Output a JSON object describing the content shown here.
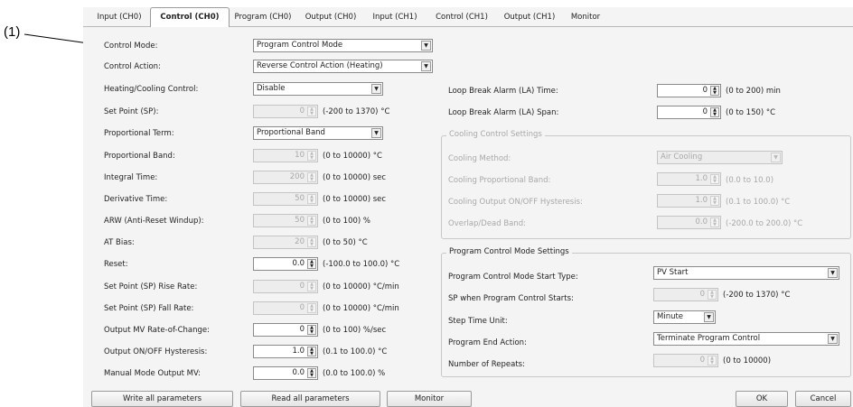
{
  "callout": "(1)",
  "tabs": [
    "Input (CH0)",
    "Control (CH0)",
    "Program (CH0)",
    "Output (CH0)",
    "Input (CH1)",
    "Control (CH1)",
    "Output (CH1)",
    "Monitor"
  ],
  "active_tab": "Control (CH0)",
  "left": {
    "control_mode": {
      "label": "Control Mode:",
      "value": "Program Control Mode"
    },
    "control_action": {
      "label": "Control Action:",
      "value": "Reverse Control Action (Heating)"
    },
    "heating_cooling": {
      "label": "Heating/Cooling Control:",
      "value": "Disable"
    },
    "set_point": {
      "label": "Set Point (SP):",
      "value": "0",
      "range": "(-200 to 1370) °C"
    },
    "proportional_term": {
      "label": "Proportional Term:",
      "value": "Proportional Band"
    },
    "proportional_band": {
      "label": "Proportional Band:",
      "value": "10",
      "range": "(0 to 10000) °C"
    },
    "integral_time": {
      "label": "Integral Time:",
      "value": "200",
      "range": "(0 to 10000) sec"
    },
    "derivative_time": {
      "label": "Derivative Time:",
      "value": "50",
      "range": "(0 to 10000) sec"
    },
    "arw": {
      "label": "ARW (Anti-Reset Windup):",
      "value": "50",
      "range": "(0 to 100) %"
    },
    "at_bias": {
      "label": "AT Bias:",
      "value": "20",
      "range": "(0 to 50) °C"
    },
    "reset": {
      "label": "Reset:",
      "value": "0.0",
      "range": "(-100.0 to 100.0) °C"
    },
    "sp_rise": {
      "label": "Set Point (SP) Rise Rate:",
      "value": "0",
      "range": "(0 to 10000) °C/min"
    },
    "sp_fall": {
      "label": "Set Point (SP) Fall Rate:",
      "value": "0",
      "range": "(0 to 10000) °C/min"
    },
    "mv_rate": {
      "label": "Output MV Rate-of-Change:",
      "value": "0",
      "range": "(0 to 100) %/sec"
    },
    "onoff_hyst": {
      "label": "Output ON/OFF Hysteresis:",
      "value": "1.0",
      "range": "(0.1 to 100.0) °C"
    },
    "manual_mv": {
      "label": "Manual Mode Output MV:",
      "value": "0.0",
      "range": "(0.0 to 100.0) %"
    }
  },
  "right": {
    "la_time": {
      "label": "Loop Break Alarm (LA) Time:",
      "value": "0",
      "range": "(0 to 200) min"
    },
    "la_span": {
      "label": "Loop Break Alarm (LA) Span:",
      "value": "0",
      "range": "(0 to 150) °C"
    },
    "cooling": {
      "title": "Cooling Control Settings",
      "method": {
        "label": "Cooling Method:",
        "value": "Air Cooling"
      },
      "prop_band": {
        "label": "Cooling Proportional Band:",
        "value": "1.0",
        "range": "(0.0 to 10.0)"
      },
      "onoff_hyst": {
        "label": "Cooling Output ON/OFF Hysteresis:",
        "value": "1.0",
        "range": "(0.1 to 100.0) °C"
      },
      "overlap": {
        "label": "Overlap/Dead Band:",
        "value": "0.0",
        "range": "(-200.0 to 200.0) °C"
      }
    },
    "program": {
      "title": "Program Control Mode Settings",
      "start_type": {
        "label": "Program Control Mode Start Type:",
        "value": "PV Start"
      },
      "sp_start": {
        "label": "SP when Program Control Starts:",
        "value": "0",
        "range": "(-200 to 1370) °C"
      },
      "step_unit": {
        "label": "Step Time Unit:",
        "value": "Minute"
      },
      "end_action": {
        "label": "Program End Action:",
        "value": "Terminate Program Control"
      },
      "repeats": {
        "label": "Number of Repeats:",
        "value": "0",
        "range": "(0 to 10000)"
      }
    }
  },
  "buttons": {
    "write": "Write all parameters",
    "read": "Read all parameters",
    "monitor": "Monitor",
    "ok": "OK",
    "cancel": "Cancel"
  }
}
